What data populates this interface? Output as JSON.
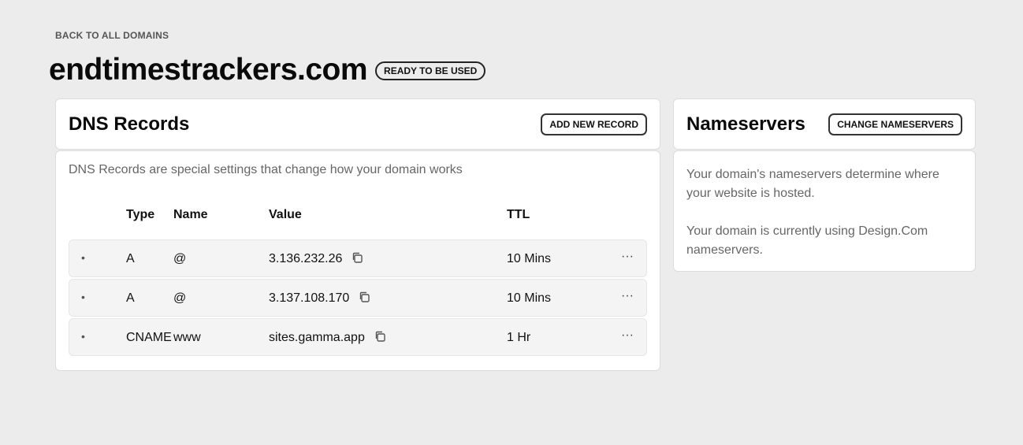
{
  "back_link": "BACK TO ALL DOMAINS",
  "domain": {
    "name": "endtimestrackers.com",
    "status": "READY TO BE USED"
  },
  "dns": {
    "title": "DNS Records",
    "add_button": "ADD NEW RECORD",
    "description": "DNS Records are special settings that change how your domain works",
    "columns": {
      "type": "Type",
      "name": "Name",
      "value": "Value",
      "ttl": "TTL"
    },
    "records": [
      {
        "type": "A",
        "name": "@",
        "value": "3.136.232.26",
        "ttl": "10 Mins"
      },
      {
        "type": "A",
        "name": "@",
        "value": "3.137.108.170",
        "ttl": "10 Mins"
      },
      {
        "type": "CNAME",
        "name": "www",
        "value": "sites.gamma.app",
        "ttl": "1 Hr"
      }
    ]
  },
  "nameservers": {
    "title": "Nameservers",
    "change_button": "CHANGE NAMESERVERS",
    "desc1": "Your domain's nameservers determine where your website is hosted.",
    "desc2": "Your domain is currently using Design.Com nameservers."
  },
  "icons": {
    "copy": "copy-icon",
    "more": "more-horizontal-icon",
    "bullet": "bullet-icon"
  }
}
